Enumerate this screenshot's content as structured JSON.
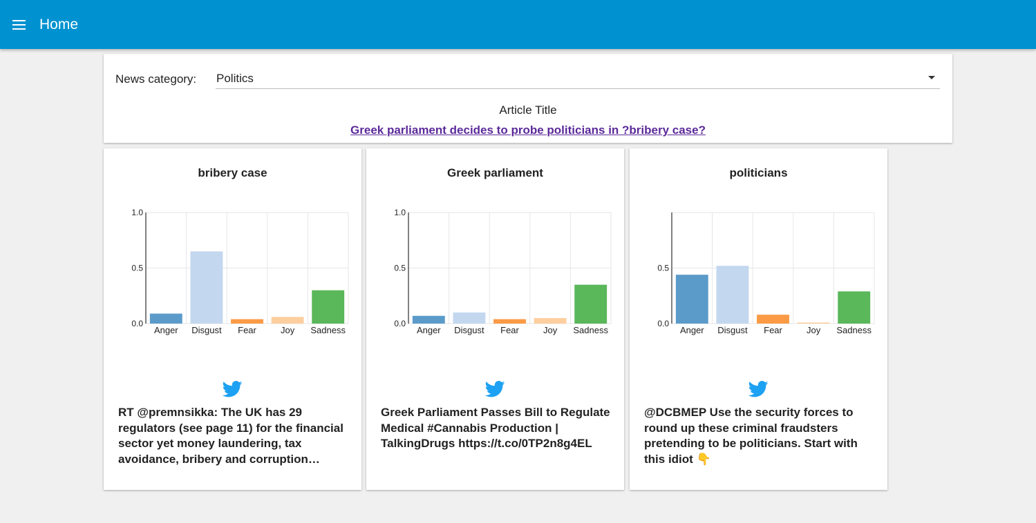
{
  "app": {
    "title": "Home",
    "menu_icon": "hamburger-menu-icon",
    "accent_color": "#0092d0"
  },
  "filter": {
    "label": "News category:",
    "selected": "Politics"
  },
  "article": {
    "heading": "Article Title",
    "title": "Greek parliament decides to probe politicians in ?bribery case?"
  },
  "emotion_colors": {
    "Anger": "#5b9bca",
    "Disgust": "#c3d7ef",
    "Fear": "#fb9b46",
    "Joy": "#fdcf9f",
    "Sadness": "#5ab75a"
  },
  "cards": [
    {
      "keyword": "bribery case",
      "icon": "twitter-icon",
      "tweet": "RT @premnsikka: The UK has 29 regulators (see page 11) for the financial sector yet money laundering, tax avoidance, bribery and corruption…"
    },
    {
      "keyword": "Greek parliament",
      "icon": "twitter-icon",
      "tweet": "Greek Parliament Passes Bill to Regulate Medical #Cannabis Production | TalkingDrugs https://t.co/0TP2n8g4EL"
    },
    {
      "keyword": "politicians",
      "icon": "twitter-icon",
      "tweet": "@DCBMEP Use the security forces to round up these criminal fraudsters pretending to be politicians. Start with this idiot 👇"
    }
  ],
  "chart_data": [
    {
      "type": "bar",
      "categories": [
        "Anger",
        "Disgust",
        "Fear",
        "Joy",
        "Sadness"
      ],
      "values": [
        0.09,
        0.65,
        0.04,
        0.06,
        0.3
      ],
      "yticks": [
        "0.0",
        "0.5",
        "1.0"
      ],
      "ylim": [
        0,
        1.0
      ],
      "grid": true
    },
    {
      "type": "bar",
      "categories": [
        "Anger",
        "Disgust",
        "Fear",
        "Joy",
        "Sadness"
      ],
      "values": [
        0.07,
        0.1,
        0.04,
        0.05,
        0.35
      ],
      "yticks": [
        "0.0",
        "0.5",
        "1.0"
      ],
      "ylim": [
        0,
        1.0
      ],
      "grid": true
    },
    {
      "type": "bar",
      "categories": [
        "Anger",
        "Disgust",
        "Fear",
        "Joy",
        "Sadness"
      ],
      "values": [
        0.44,
        0.52,
        0.08,
        0.01,
        0.29
      ],
      "yticks": [
        "0.0",
        "0.5"
      ],
      "ylim": [
        0,
        1.0
      ],
      "grid": true
    }
  ]
}
